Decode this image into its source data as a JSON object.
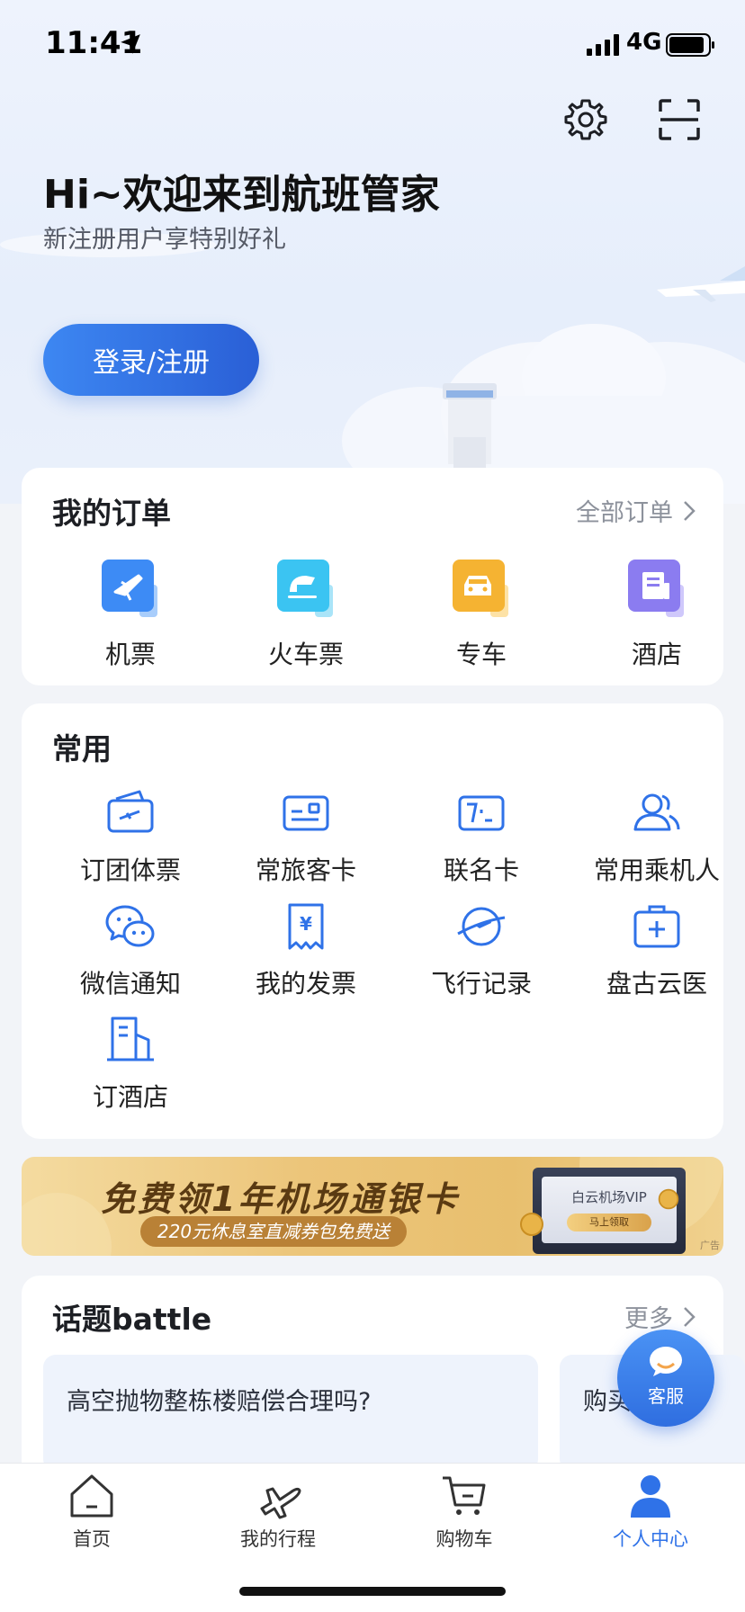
{
  "status_bar": {
    "time": "11:41",
    "network": "4G"
  },
  "header": {
    "title": "Hi~欢迎来到航班管家",
    "subtitle": "新注册用户享特别好礼",
    "login_button": "登录/注册",
    "icons": [
      "gear-icon",
      "scan-icon"
    ]
  },
  "orders": {
    "title": "我的订单",
    "all_orders": "全部订单",
    "items": [
      {
        "label": "机票",
        "icon": "plane-ticket-icon",
        "color": "#3d8bf5"
      },
      {
        "label": "火车票",
        "icon": "train-ticket-icon",
        "color": "#3bc4f2"
      },
      {
        "label": "专车",
        "icon": "car-icon",
        "color": "#f5b332"
      },
      {
        "label": "酒店",
        "icon": "hotel-icon",
        "color": "#8b7cf0"
      }
    ]
  },
  "common": {
    "title": "常用",
    "items": [
      {
        "label": "订团体票",
        "icon": "group-ticket-icon"
      },
      {
        "label": "常旅客卡",
        "icon": "frequent-flyer-card-icon"
      },
      {
        "label": "联名卡",
        "icon": "co-branded-card-icon"
      },
      {
        "label": "常用乘机人",
        "icon": "passengers-icon"
      },
      {
        "label": "微信通知",
        "icon": "wechat-icon"
      },
      {
        "label": "我的发票",
        "icon": "invoice-icon"
      },
      {
        "label": "飞行记录",
        "icon": "flight-record-icon"
      },
      {
        "label": "盘古云医",
        "icon": "medical-kit-icon"
      },
      {
        "label": "订酒店",
        "icon": "hotel-building-icon"
      }
    ]
  },
  "banner": {
    "title": "免费领1年机场通银卡",
    "subtitle": "220元休息室直减券包免费送",
    "card_title": "白云机场VIP",
    "card_button": "马上领取",
    "ad_tag": "广告"
  },
  "topics": {
    "title": "话题battle",
    "more": "更多",
    "items": [
      "高空抛物整栋楼赔偿合理吗?",
      "购买"
    ]
  },
  "fab": {
    "label": "客服"
  },
  "tabbar": {
    "items": [
      {
        "label": "首页",
        "icon": "home-icon"
      },
      {
        "label": "我的行程",
        "icon": "plane-icon"
      },
      {
        "label": "购物车",
        "icon": "cart-icon"
      },
      {
        "label": "个人中心",
        "icon": "person-icon",
        "active": true
      }
    ],
    "active_color": "#2f72e8"
  }
}
